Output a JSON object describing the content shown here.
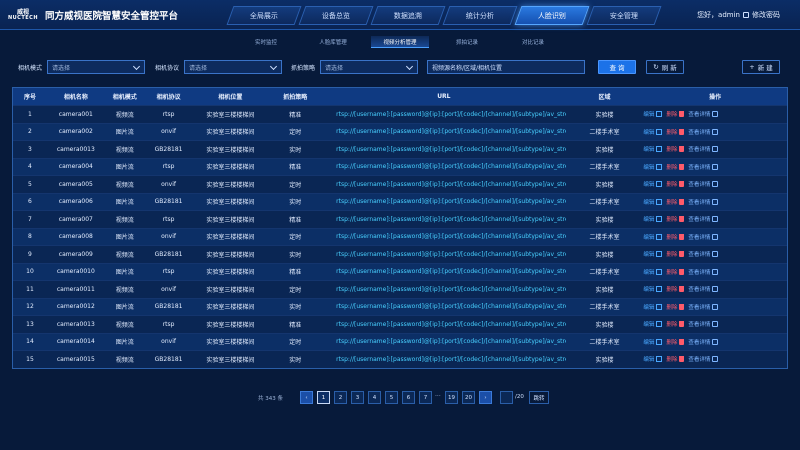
{
  "header": {
    "logo_line1": "威视",
    "logo_line2": "NUCTECH",
    "title": "同方威视医院智慧安全管控平台",
    "nav": [
      {
        "label": "全局展示"
      },
      {
        "label": "设备总览"
      },
      {
        "label": "数据追溯"
      },
      {
        "label": "统计分析"
      },
      {
        "label": "人脸识别",
        "active": true
      },
      {
        "label": "安全管理"
      }
    ],
    "greeting": "您好，admin",
    "change_password": "修改密码"
  },
  "subtabs": [
    {
      "label": "实时监控"
    },
    {
      "label": "人脸库管理"
    },
    {
      "label": "视频分析管理",
      "active": true
    },
    {
      "label": "抓拍记录"
    },
    {
      "label": "对比记录"
    }
  ],
  "filters": {
    "mode_label": "相机模式",
    "mode_placeholder": "请选择",
    "protocol_label": "相机协议",
    "protocol_placeholder": "请选择",
    "strategy_label": "抓拍策略",
    "strategy_placeholder": "请选择",
    "search_placeholder": "视频源名称/区域/相机位置",
    "query": "查 询",
    "refresh": "刷 新",
    "new": "新 建"
  },
  "table": {
    "headers": {
      "no": "序号",
      "name": "相机名称",
      "mode": "相机模式",
      "protocol": "相机协议",
      "position": "相机位置",
      "strategy": "抓拍策略",
      "url": "URL",
      "area": "区域",
      "ops": "操作"
    },
    "ops": {
      "edit": "编辑",
      "delete": "删除",
      "view": "查看详情"
    },
    "rows": [
      {
        "no": "1",
        "name": "camera001",
        "mode": "视频流",
        "protocol": "rtsp",
        "position": "实验室三楼楼梯间",
        "strategy": "精准",
        "url": "rtsp://[username]:[password]@[ip]:[port]/[codec]/[channel]/[subtype]/av_stream",
        "area": "实验楼"
      },
      {
        "no": "2",
        "name": "camera002",
        "mode": "图片流",
        "protocol": "onvif",
        "position": "实验室三楼楼梯间",
        "strategy": "定时",
        "url": "rtsp://[username]:[password]@[ip]:[port]/[codec]/[channel]/[subtype]/av_stream",
        "area": "二楼手术室"
      },
      {
        "no": "3",
        "name": "camera0013",
        "mode": "视频流",
        "protocol": "GB28181",
        "position": "实验室三楼楼梯间",
        "strategy": "实时",
        "url": "rtsp://[username]:[password]@[ip]:[port]/[codec]/[channel]/[subtype]/av_stream",
        "area": "实验楼"
      },
      {
        "no": "4",
        "name": "camera004",
        "mode": "图片流",
        "protocol": "rtsp",
        "position": "实验室三楼楼梯间",
        "strategy": "精准",
        "url": "rtsp://[username]:[password]@[ip]:[port]/[codec]/[channel]/[subtype]/av_stream",
        "area": "二楼手术室"
      },
      {
        "no": "5",
        "name": "camera005",
        "mode": "视频流",
        "protocol": "onvif",
        "position": "实验室三楼楼梯间",
        "strategy": "定时",
        "url": "rtsp://[username]:[password]@[ip]:[port]/[codec]/[channel]/[subtype]/av_stream",
        "area": "实验楼"
      },
      {
        "no": "6",
        "name": "camera006",
        "mode": "图片流",
        "protocol": "GB28181",
        "position": "实验室三楼楼梯间",
        "strategy": "实时",
        "url": "rtsp://[username]:[password]@[ip]:[port]/[codec]/[channel]/[subtype]/av_stream",
        "area": "二楼手术室"
      },
      {
        "no": "7",
        "name": "camera007",
        "mode": "视频流",
        "protocol": "rtsp",
        "position": "实验室三楼楼梯间",
        "strategy": "精准",
        "url": "rtsp://[username]:[password]@[ip]:[port]/[codec]/[channel]/[subtype]/av_stream",
        "area": "实验楼"
      },
      {
        "no": "8",
        "name": "camera008",
        "mode": "图片流",
        "protocol": "onvif",
        "position": "实验室三楼楼梯间",
        "strategy": "定时",
        "url": "rtsp://[username]:[password]@[ip]:[port]/[codec]/[channel]/[subtype]/av_stream",
        "area": "二楼手术室"
      },
      {
        "no": "9",
        "name": "camera009",
        "mode": "视频流",
        "protocol": "GB28181",
        "position": "实验室三楼楼梯间",
        "strategy": "实时",
        "url": "rtsp://[username]:[password]@[ip]:[port]/[codec]/[channel]/[subtype]/av_stream",
        "area": "实验楼"
      },
      {
        "no": "10",
        "name": "camera0010",
        "mode": "图片流",
        "protocol": "rtsp",
        "position": "实验室三楼楼梯间",
        "strategy": "精准",
        "url": "rtsp://[username]:[password]@[ip]:[port]/[codec]/[channel]/[subtype]/av_stream",
        "area": "二楼手术室"
      },
      {
        "no": "11",
        "name": "camera0011",
        "mode": "视频流",
        "protocol": "onvif",
        "position": "实验室三楼楼梯间",
        "strategy": "定时",
        "url": "rtsp://[username]:[password]@[ip]:[port]/[codec]/[channel]/[subtype]/av_stream",
        "area": "实验楼"
      },
      {
        "no": "12",
        "name": "camera0012",
        "mode": "图片流",
        "protocol": "GB28181",
        "position": "实验室三楼楼梯间",
        "strategy": "实时",
        "url": "rtsp://[username]:[password]@[ip]:[port]/[codec]/[channel]/[subtype]/av_stream",
        "area": "二楼手术室"
      },
      {
        "no": "13",
        "name": "camera0013",
        "mode": "视频流",
        "protocol": "rtsp",
        "position": "实验室三楼楼梯间",
        "strategy": "精准",
        "url": "rtsp://[username]:[password]@[ip]:[port]/[codec]/[channel]/[subtype]/av_stream",
        "area": "实验楼"
      },
      {
        "no": "14",
        "name": "camera0014",
        "mode": "图片流",
        "protocol": "onvif",
        "position": "实验室三楼楼梯间",
        "strategy": "定时",
        "url": "rtsp://[username]:[password]@[ip]:[port]/[codec]/[channel]/[subtype]/av_stream",
        "area": "二楼手术室"
      },
      {
        "no": "15",
        "name": "camera0015",
        "mode": "视频流",
        "protocol": "GB28181",
        "position": "实验室三楼楼梯间",
        "strategy": "实时",
        "url": "rtsp://[username]:[password]@[ip]:[port]/[codec]/[channel]/[subtype]/av_stream",
        "area": "实验楼"
      }
    ]
  },
  "pagination": {
    "total": "共 343 条",
    "pages": [
      "1",
      "2",
      "3",
      "4",
      "5",
      "6",
      "7"
    ],
    "ellipsis": "···",
    "tail_pages": [
      "19",
      "20"
    ],
    "current": "1",
    "total_pages": "/20",
    "go": "跳转",
    "prev": "‹",
    "next": "›"
  }
}
